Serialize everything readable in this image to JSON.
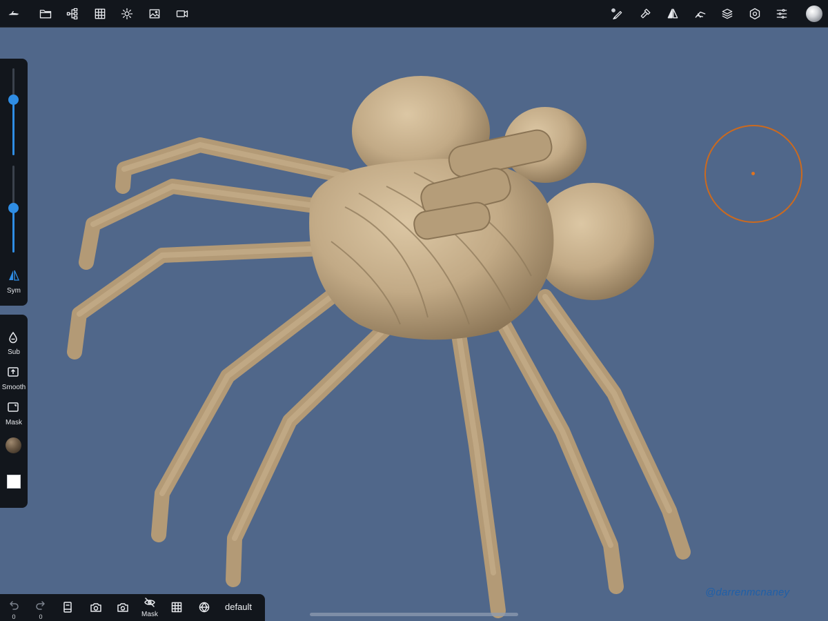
{
  "colors": {
    "background": "#50678a",
    "toolbar": "#12161c",
    "accent": "#2f8de4",
    "brush_cursor": "#cc6a1e",
    "model": "#c2aa86",
    "watermark": "#1f5fa8"
  },
  "top_toolbar": {
    "left_icons": [
      "nomad-logo-icon",
      "folder-icon",
      "scene-tree-icon",
      "grid-icon",
      "light-icon",
      "image-icon",
      "video-camera-icon"
    ],
    "right_icons": [
      "brush-pen-icon",
      "hammer-icon",
      "symmetry-icon",
      "interaction-icon",
      "layers-icon",
      "settings-icon",
      "sliders-icon",
      "matcap-sphere-icon"
    ]
  },
  "left_panel": {
    "sliders": [
      {
        "name": "radius",
        "value": 0.6
      },
      {
        "name": "intensity",
        "value": 0.4
      }
    ],
    "sym_label": "Sym",
    "tools": [
      {
        "icon": "drop-minus-icon",
        "label": "Sub"
      },
      {
        "icon": "smooth-icon",
        "label": "Smooth"
      },
      {
        "icon": "mask-icon",
        "label": "Mask"
      }
    ]
  },
  "bottom_toolbar": {
    "undo_count": "0",
    "redo_count": "0",
    "mask_label": "Mask",
    "preset_label": "default",
    "icons": [
      "undo-icon",
      "redo-icon",
      "book-icon",
      "camera-icon",
      "camera-switch-icon",
      "eye-off-icon",
      "grid-icon",
      "wireframe-icon"
    ]
  },
  "watermark": "@darrenmcnaney"
}
